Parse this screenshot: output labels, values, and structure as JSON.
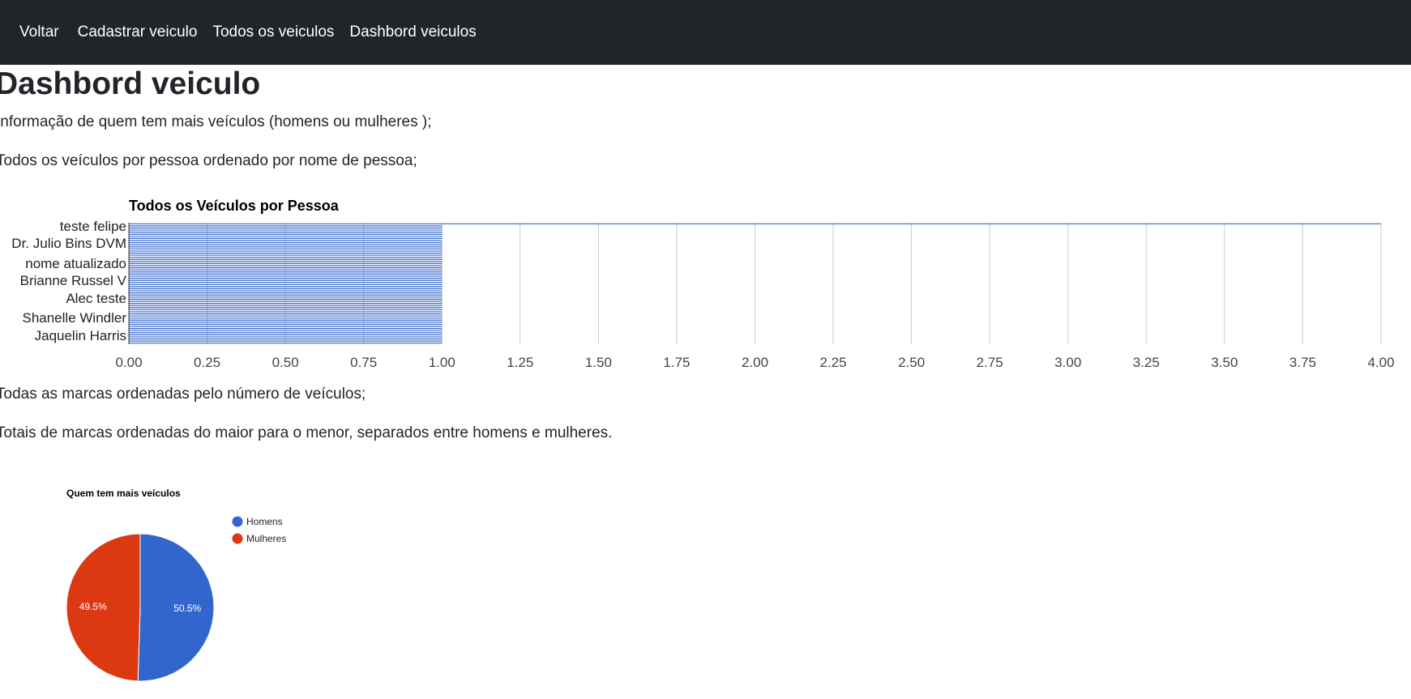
{
  "nav": {
    "items": [
      "Voltar",
      "Cadastrar veiculo",
      "Todos os veiculos",
      "Dashbord veiculos"
    ]
  },
  "page": {
    "title": "Dashbord veiculo",
    "paragraphs": [
      "Informação de quem tem mais veículos (homens ou mulheres );",
      "Todos os veículos por pessoa ordenado por nome de pessoa;",
      "Todas as marcas ordenadas pelo número de veículos;",
      "Totais de marcas ordenadas do maior para o menor, separados entre homens e mulheres."
    ]
  },
  "colors": {
    "navbar": "#212529",
    "bar": "#3366cc",
    "homens": "#3366cc",
    "mulheres": "#dc3912",
    "grid": "#cccccc"
  },
  "chart_data": [
    {
      "type": "bar",
      "orientation": "horizontal",
      "title": "Todos os Veículos por Pessoa",
      "visible_category_labels": [
        "teste felipe",
        "Dr. Julio Bins DVM",
        "nome atualizado",
        "Brianne Russel V",
        "Alec teste",
        "Shanelle Windler",
        "Jaquelin Harris"
      ],
      "values": [
        4,
        1,
        1,
        1,
        1,
        1,
        1,
        1,
        1,
        1,
        1,
        1,
        1,
        1,
        1,
        1,
        1,
        1,
        1,
        1,
        1,
        1,
        1,
        1,
        1,
        1,
        1,
        1,
        1,
        1,
        1,
        1,
        1,
        1,
        1,
        1,
        1,
        1,
        1,
        1,
        1,
        1,
        1,
        1,
        1,
        1,
        1,
        1,
        1,
        1,
        1,
        1,
        1,
        1,
        1,
        1,
        1,
        1
      ],
      "xlim": [
        0,
        4
      ],
      "xticks": [
        "0.00",
        "0.25",
        "0.50",
        "0.75",
        "1.00",
        "1.25",
        "1.50",
        "1.75",
        "2.00",
        "2.25",
        "2.50",
        "2.75",
        "3.00",
        "3.25",
        "3.50",
        "3.75",
        "4.00"
      ],
      "grid": true,
      "legend": "none"
    },
    {
      "type": "pie",
      "title": "Quem tem mais veículos",
      "slices": [
        {
          "label": "Homens",
          "value": 50.5,
          "display": "50.5%"
        },
        {
          "label": "Mulheres",
          "value": 49.5,
          "display": "49.5%"
        }
      ],
      "legend": "right"
    }
  ]
}
